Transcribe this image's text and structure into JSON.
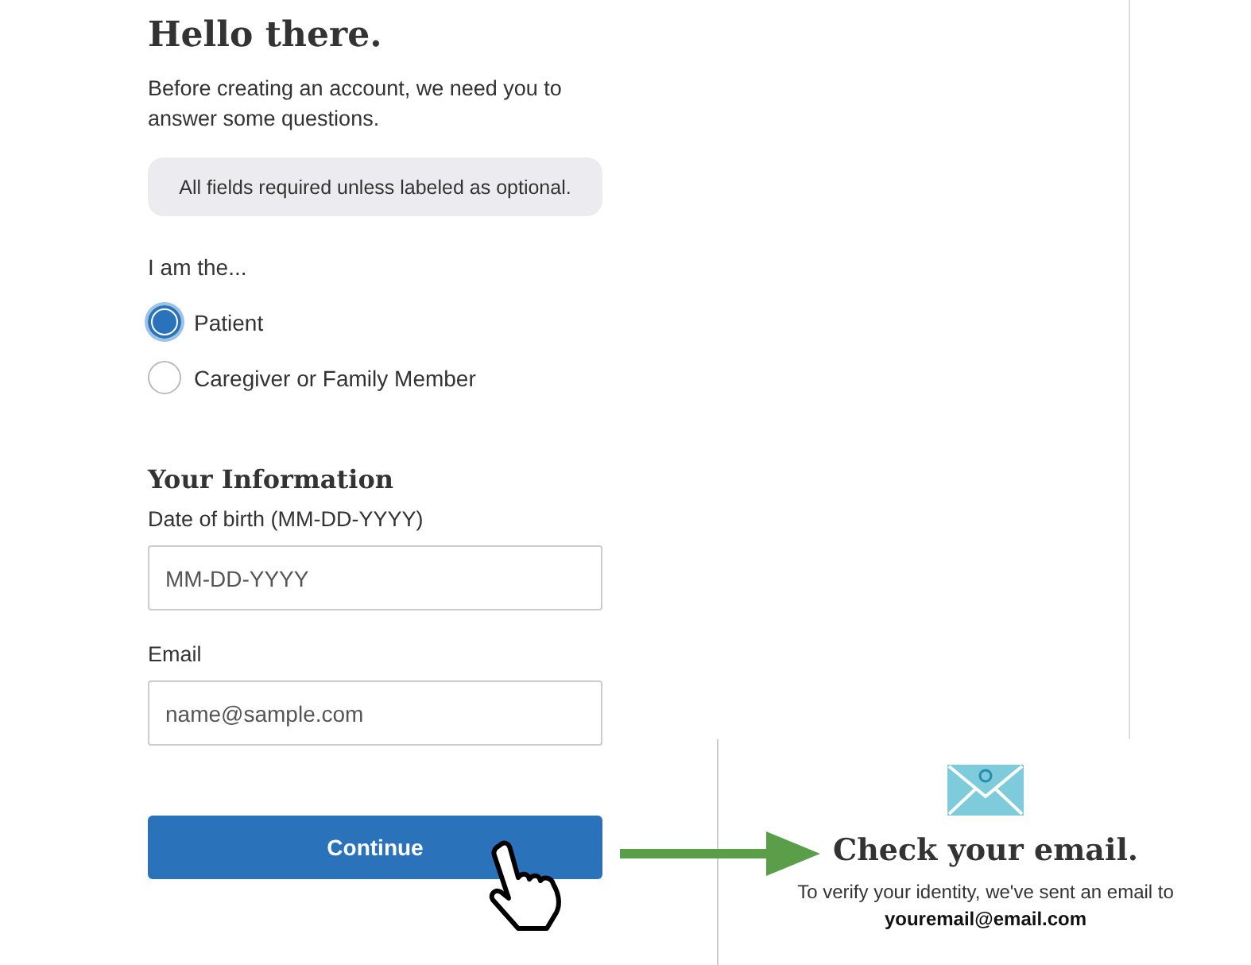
{
  "form": {
    "heading": "Hello there.",
    "intro": "Before creating an account, we need you to answer some questions.",
    "notice": "All fields required unless labeled as optional.",
    "role_question": "I am the...",
    "roles": [
      {
        "label": "Patient",
        "selected": true
      },
      {
        "label": "Caregiver or Family Member",
        "selected": false
      }
    ],
    "section_heading": "Your Information",
    "fields": [
      {
        "label": "Date of birth (MM-DD-YYYY)",
        "placeholder": "MM-DD-YYYY"
      },
      {
        "label": "Email",
        "placeholder": "name@sample.com"
      }
    ],
    "button": "Continue"
  },
  "confirmation": {
    "title": "Check your email.",
    "message": "To verify your identity, we've sent an email to",
    "email": "youremail@email.com"
  }
}
